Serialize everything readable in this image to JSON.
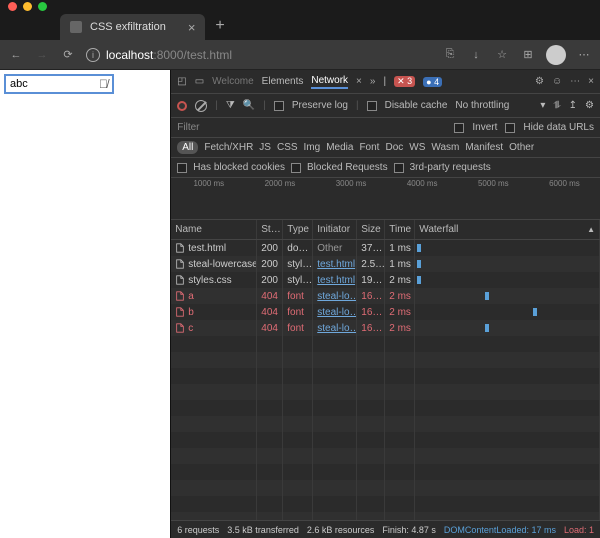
{
  "browser": {
    "tab_title": "CSS exfiltration",
    "url_host": "localhost",
    "url_port_path": ":8000/test.html"
  },
  "page": {
    "input_value": "abc"
  },
  "devtools": {
    "panels": {
      "welcome": "Welcome",
      "elements": "Elements",
      "network": "Network"
    },
    "badges": {
      "errors": "3",
      "info": "4"
    },
    "toolbar": {
      "preserve_log": "Preserve log",
      "disable_cache": "Disable cache",
      "throttling": "No throttling"
    },
    "filter": {
      "placeholder": "Filter",
      "invert": "Invert",
      "hide_data": "Hide data URLs"
    },
    "types": [
      "All",
      "Fetch/XHR",
      "JS",
      "CSS",
      "Img",
      "Media",
      "Font",
      "Doc",
      "WS",
      "Wasm",
      "Manifest",
      "Other"
    ],
    "opts": {
      "blocked_cookies": "Has blocked cookies",
      "blocked_req": "Blocked Requests",
      "third_party": "3rd-party requests"
    },
    "timeline_ticks": [
      "1000 ms",
      "2000 ms",
      "3000 ms",
      "4000 ms",
      "5000 ms",
      "6000 ms"
    ],
    "columns": {
      "name": "Name",
      "status": "St…",
      "type": "Type",
      "initiator": "Initiator",
      "size": "Size",
      "time": "Time",
      "waterfall": "Waterfall"
    },
    "rows": [
      {
        "name": "test.html",
        "status": "200",
        "type": "do…",
        "initiator": "Other",
        "initiator_link": false,
        "size": "37…",
        "time": "1 ms",
        "err": false,
        "wf": 2
      },
      {
        "name": "steal-lowercase.…",
        "status": "200",
        "type": "styl…",
        "initiator": "test.html",
        "initiator_link": true,
        "size": "2.5…",
        "time": "1 ms",
        "err": false,
        "wf": 2
      },
      {
        "name": "styles.css",
        "status": "200",
        "type": "styl…",
        "initiator": "test.html",
        "initiator_link": true,
        "size": "19…",
        "time": "2 ms",
        "err": false,
        "wf": 2
      },
      {
        "name": "a",
        "status": "404",
        "type": "font",
        "initiator": "steal-lo…",
        "initiator_link": true,
        "size": "16…",
        "time": "2 ms",
        "err": true,
        "wf": 70
      },
      {
        "name": "b",
        "status": "404",
        "type": "font",
        "initiator": "steal-lo…",
        "initiator_link": true,
        "size": "16…",
        "time": "2 ms",
        "err": true,
        "wf": 118
      },
      {
        "name": "c",
        "status": "404",
        "type": "font",
        "initiator": "steal-lo…",
        "initiator_link": true,
        "size": "16…",
        "time": "2 ms",
        "err": true,
        "wf": 70
      }
    ],
    "status_bar": {
      "requests": "6 requests",
      "transferred": "3.5 kB transferred",
      "resources": "2.6 kB resources",
      "finish": "Finish: 4.87 s",
      "dcl": "DOMContentLoaded: 17 ms",
      "load": "Load: 1"
    }
  }
}
